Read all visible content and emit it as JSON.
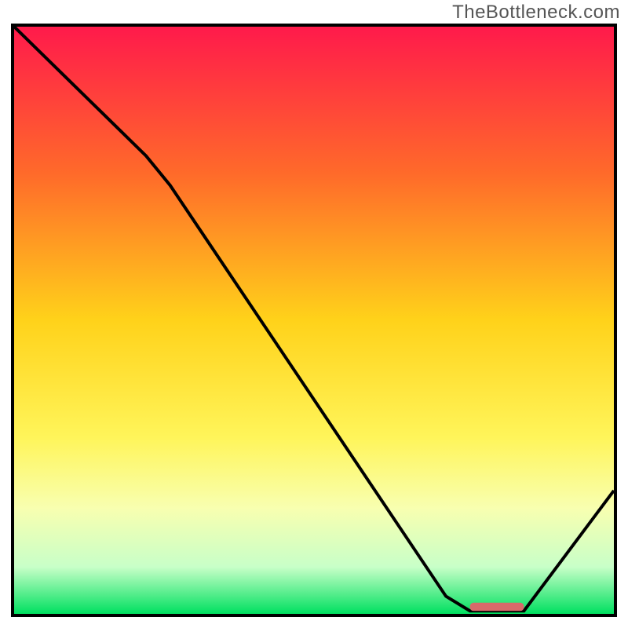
{
  "watermark": "TheBottleneck.com",
  "chart_data": {
    "type": "line",
    "title": "",
    "xlabel": "",
    "ylabel": "",
    "xlim": [
      0,
      100
    ],
    "ylim": [
      0,
      100
    ],
    "gradient_stops": [
      {
        "offset": 0.0,
        "color": "#ff1a4b"
      },
      {
        "offset": 0.25,
        "color": "#ff6a2a"
      },
      {
        "offset": 0.5,
        "color": "#ffd21a"
      },
      {
        "offset": 0.7,
        "color": "#fff55a"
      },
      {
        "offset": 0.82,
        "color": "#f8ffb0"
      },
      {
        "offset": 0.92,
        "color": "#c8ffc8"
      },
      {
        "offset": 1.0,
        "color": "#00e060"
      }
    ],
    "curve": [
      {
        "x": 0,
        "y": 100
      },
      {
        "x": 22,
        "y": 78
      },
      {
        "x": 26,
        "y": 73
      },
      {
        "x": 72,
        "y": 3
      },
      {
        "x": 76,
        "y": 0.5
      },
      {
        "x": 85,
        "y": 0.5
      },
      {
        "x": 100,
        "y": 21
      }
    ],
    "marker": {
      "x_start": 76,
      "x_end": 85,
      "y": 1.2,
      "color": "#d86a6a"
    }
  }
}
